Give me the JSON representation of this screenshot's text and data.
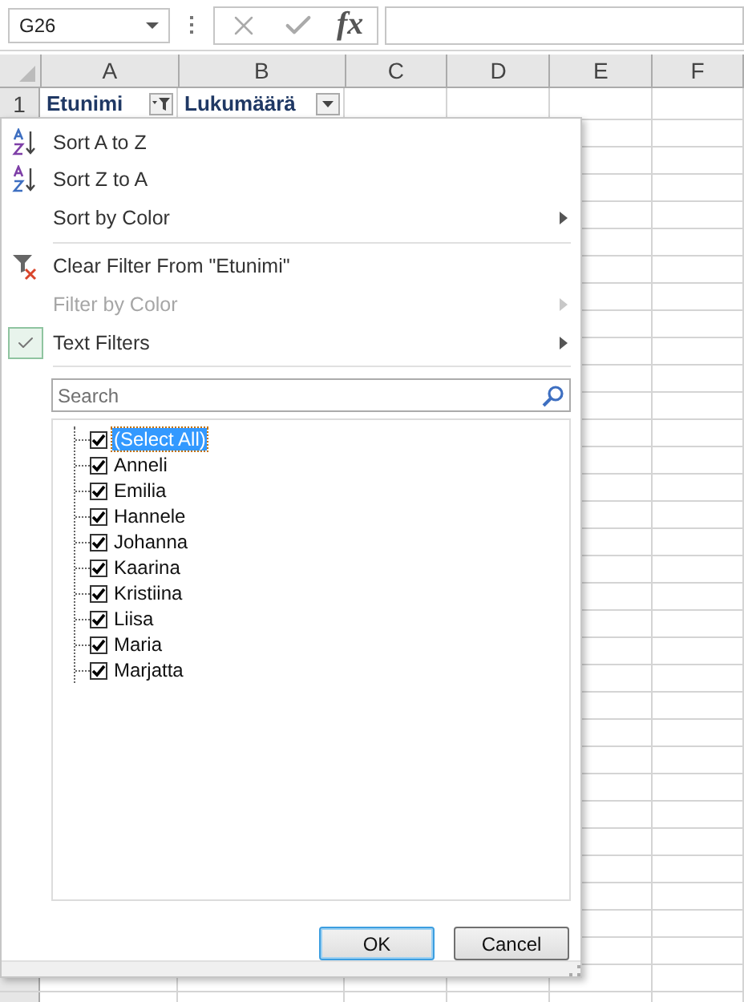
{
  "formula_bar": {
    "name_box": "G26",
    "function_label": "fx"
  },
  "columns": [
    "A",
    "B",
    "C",
    "D",
    "E",
    "F"
  ],
  "header_row": {
    "number": "1",
    "cells": [
      {
        "text": "Etunimi",
        "filtered": true
      },
      {
        "text": "Lukumäärä",
        "filtered": false
      }
    ]
  },
  "filter_menu": {
    "items": [
      {
        "kind": "sort_asc",
        "label": "Sort A to Z",
        "disabled": false,
        "checked": false,
        "submenu": false
      },
      {
        "kind": "sort_desc",
        "label": "Sort Z to A",
        "disabled": false,
        "checked": false,
        "submenu": false
      },
      {
        "kind": "plain",
        "label": "Sort by Color",
        "disabled": false,
        "checked": false,
        "submenu": true
      },
      {
        "kind": "separator"
      },
      {
        "kind": "clear_filter",
        "label": "Clear Filter From \"Etunimi\"",
        "disabled": false,
        "checked": false,
        "submenu": false
      },
      {
        "kind": "plain",
        "label": "Filter by Color",
        "disabled": true,
        "checked": false,
        "submenu": true
      },
      {
        "kind": "plain",
        "label": "Text Filters",
        "disabled": false,
        "checked": true,
        "submenu": true
      },
      {
        "kind": "separator"
      }
    ],
    "search": {
      "placeholder": "Search"
    },
    "values": [
      {
        "label": "(Select All)",
        "checked": true,
        "selected": true
      },
      {
        "label": "Anneli",
        "checked": true,
        "selected": false
      },
      {
        "label": "Emilia",
        "checked": true,
        "selected": false
      },
      {
        "label": "Hannele",
        "checked": true,
        "selected": false
      },
      {
        "label": "Johanna",
        "checked": true,
        "selected": false
      },
      {
        "label": "Kaarina",
        "checked": true,
        "selected": false
      },
      {
        "label": "Kristiina",
        "checked": true,
        "selected": false
      },
      {
        "label": "Liisa",
        "checked": true,
        "selected": false
      },
      {
        "label": "Maria",
        "checked": true,
        "selected": false
      },
      {
        "label": "Marjatta",
        "checked": true,
        "selected": false
      }
    ],
    "buttons": [
      {
        "label": "OK",
        "primary": true
      },
      {
        "label": "Cancel",
        "primary": false
      }
    ]
  }
}
